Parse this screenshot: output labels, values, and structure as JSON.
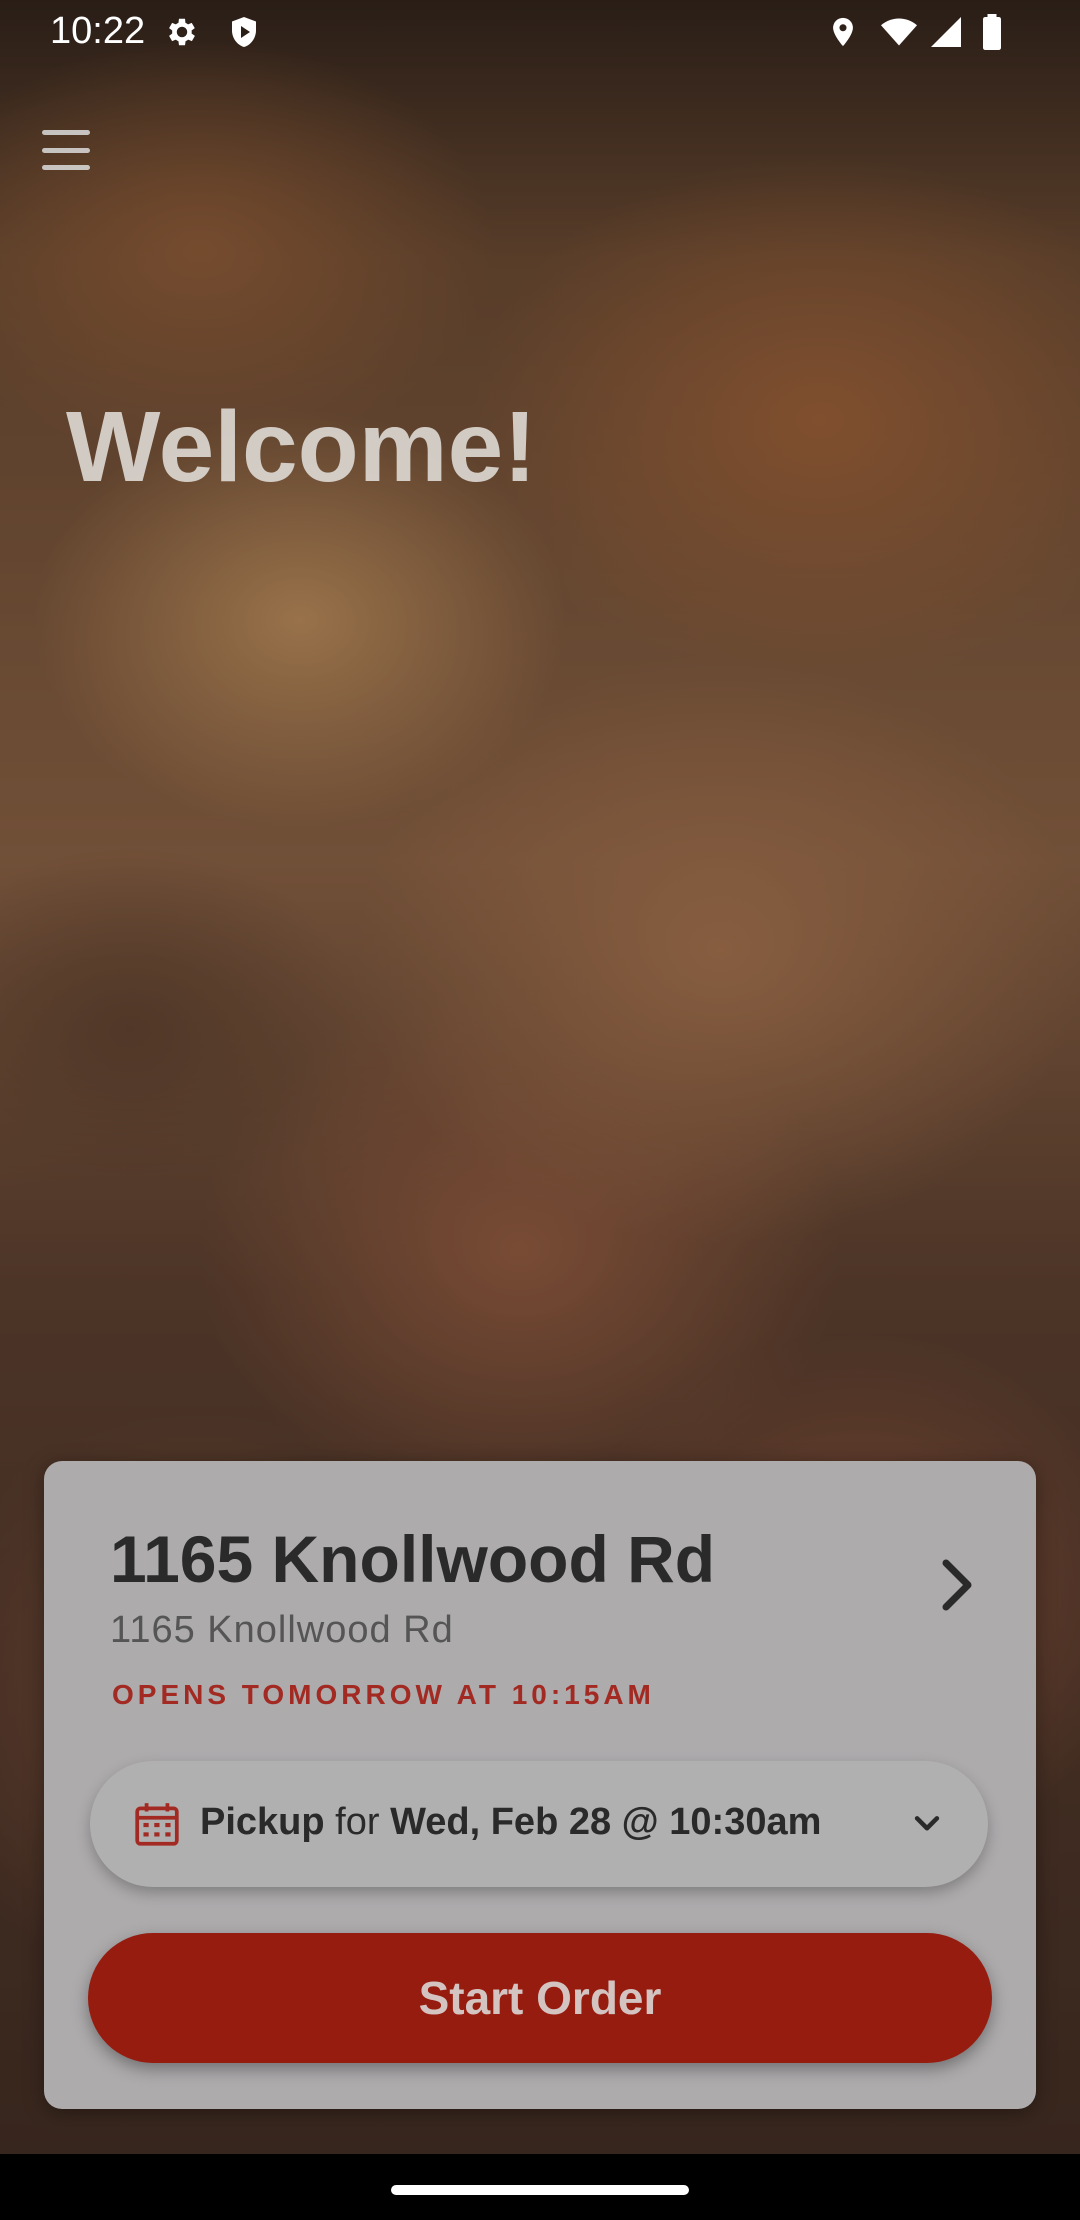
{
  "status_bar": {
    "time": "10:22",
    "icons_left": [
      "settings-icon",
      "shield-play-icon"
    ],
    "icons_right": [
      "location-icon",
      "wifi-icon",
      "signal-icon",
      "battery-icon"
    ]
  },
  "header": {
    "menu_icon": "hamburger-menu-icon",
    "welcome_text": "Welcome!"
  },
  "store_card": {
    "title": "1165 Knollwood Rd",
    "address": "1165 Knollwood Rd",
    "status": "OPENS TOMORROW AT 10:15AM",
    "chevron_icon": "chevron-right-icon"
  },
  "pickup_selector": {
    "mode": "Pickup",
    "connector": " for ",
    "datetime": "Wed, Feb 28 @ 10:30am",
    "icon": "calendar-icon",
    "dropdown_icon": "chevron-down-icon"
  },
  "start_order": {
    "label": "Start Order"
  },
  "colors": {
    "accent": "#971c10",
    "status_text": "#a32a22",
    "card_bg": "#adabac"
  }
}
